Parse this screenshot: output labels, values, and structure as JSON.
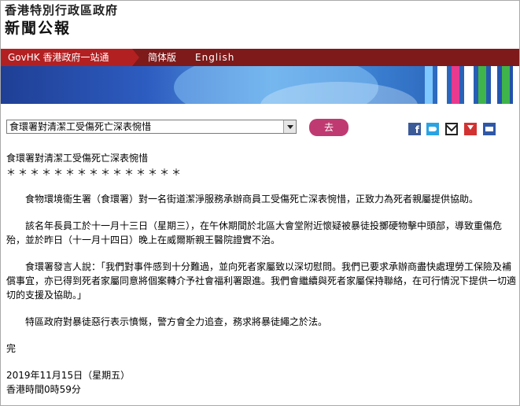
{
  "header": {
    "gov_name": "香港特別行政區政府",
    "site_title": "新聞公報"
  },
  "navbar": {
    "govhk": "GovHK 香港政府一站通",
    "simplified": "简体版",
    "english": "English",
    "accent": "#b32022",
    "background": "#7e1a1a"
  },
  "controls": {
    "select_value": "食環署對清潔工受傷死亡深表惋惜",
    "go_label": "去",
    "go_color": "#c03a72"
  },
  "share_icons": [
    "facebook-icon",
    "twitter-icon",
    "email-icon",
    "save-icon",
    "print-icon"
  ],
  "article": {
    "title": "食環署對清潔工受傷死亡深表惋惜",
    "stars": "＊＊＊＊＊＊＊＊＊＊＊＊＊＊＊",
    "paragraphs": [
      "食物環境衞生署（食環署）對一名街道潔淨服務承辦商員工受傷死亡深表惋惜，正致力為死者親屬提供協助。",
      "該名年長員工於十一月十三日（星期三），在午休期間於北區大會堂附近懷疑被暴徒投擲硬物擊中頭部，導致重傷危殆，並於昨日（十一月十四日）晚上在威爾斯親王醫院證實不治。",
      "食環署發言人說：「我們對事件感到十分難過，並向死者家屬致以深切慰問。我們已要求承辦商盡快處理勞工保險及補償事宜，亦已得到死者家屬同意將個案轉介予社會福利署跟進。我們會繼續與死者家屬保持聯絡，在可行情況下提供一切適切的支援及協助。」",
      "特區政府對暴徒惡行表示憤慨，警方會全力追查，務求將暴徒繩之於法。"
    ],
    "end_mark": "完",
    "date": "2019年11月15日（星期五）",
    "time": "香港時間0時59分"
  }
}
